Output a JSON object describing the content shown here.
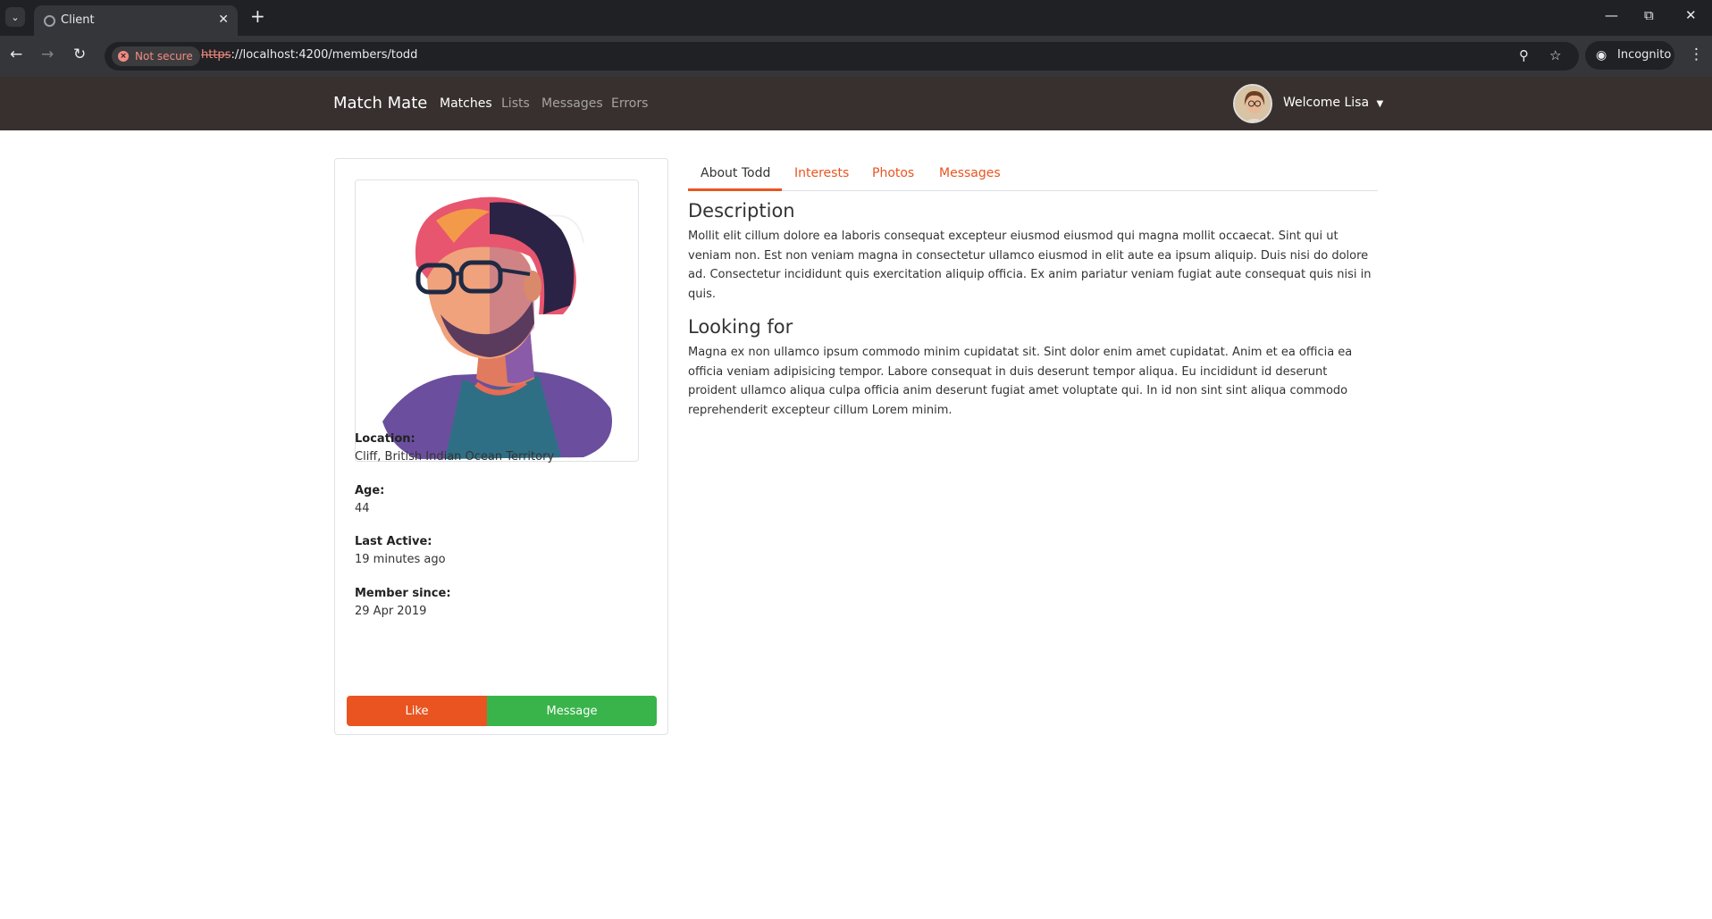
{
  "browser": {
    "tab_title": "Client",
    "security_label": "Not secure",
    "url_scheme": "https",
    "url_rest": "://localhost:4200/members/todd",
    "incognito_label": "Incognito"
  },
  "navbar": {
    "brand": "Match Mate",
    "links": [
      "Matches",
      "Lists",
      "Messages",
      "Errors"
    ],
    "active_link": "Matches",
    "welcome": "Welcome Lisa"
  },
  "member": {
    "location_label": "Location:",
    "location": "Cliff, British Indian Ocean Territory",
    "age_label": "Age:",
    "age": "44",
    "last_active_label": "Last Active:",
    "last_active": "19 minutes ago",
    "member_since_label": "Member since:",
    "member_since": "29 Apr 2019",
    "like_label": "Like",
    "message_label": "Message"
  },
  "tabs": [
    "About Todd",
    "Interests",
    "Photos",
    "Messages"
  ],
  "about": {
    "description_heading": "Description",
    "description": "Mollit elit cillum dolore ea laboris consequat excepteur eiusmod eiusmod qui magna mollit occaecat. Sint qui ut veniam non. Est non veniam magna in consectetur ullamco eiusmod in elit aute ea ipsum aliquip. Duis nisi do dolore ad. Consectetur incididunt quis exercitation aliquip officia. Ex anim pariatur veniam fugiat aute consequat quis nisi in quis.",
    "looking_for_heading": "Looking for",
    "looking_for": "Magna ex non ullamco ipsum commodo minim cupidatat sit. Sint dolor enim amet cupidatat. Anim et ea officia ea officia veniam adipisicing tempor. Labore consequat in duis deserunt tempor aliqua. Eu incididunt id deserunt proident ullamco aliqua culpa officia anim deserunt fugiat amet voluptate qui. In id non sint sint aliqua commodo reprehenderit excepteur cillum Lorem minim."
  },
  "colors": {
    "primary": "#e95420",
    "success": "#38b44a",
    "navbar": "#37302f"
  }
}
